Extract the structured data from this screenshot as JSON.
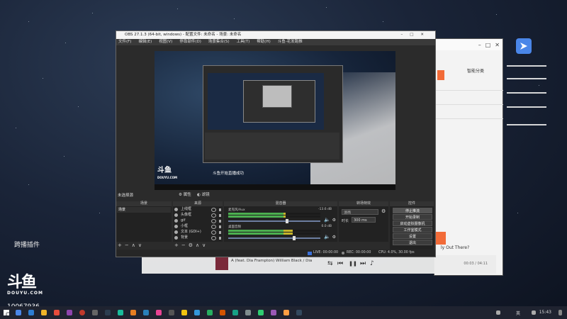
{
  "desktop": {
    "label": "跨播插件",
    "logo_text": "斗鱼",
    "logo_sub": "DOUYU.COM",
    "room_id": "10067936"
  },
  "back_window": {
    "smart_category": "智能分类",
    "question_text": "ly Out There?"
  },
  "music_player": {
    "song": "A (feat. Dia Frampton)    William Black / Dia",
    "time": "00:03 / 04:11"
  },
  "obs": {
    "title": "OBS 27.1.3 (64-bit, windows) - 配置文件: 未命名 - 场景: 未命名",
    "menu": [
      "文件(F)",
      "编辑(E)",
      "视图(V)",
      "停靠部件(D)",
      "场景集合(S)",
      "工具(T)",
      "帮助(H)",
      "斗鱼-花发跑推"
    ],
    "preview": {
      "notify": "斗鱼开始直播成功",
      "logo": "斗鱼",
      "logo_sub": "DOUYU.COM"
    },
    "toolbar": {
      "no_source": "未选择源",
      "properties": "属性",
      "filters": "滤镜"
    },
    "docks": {
      "scenes": "场景",
      "sources": "来源",
      "mixer": "混音器",
      "transitions": "转场特效",
      "controls": "控件"
    },
    "scenes": [
      "场景"
    ],
    "sources": [
      "上线框",
      "头像框",
      "gif",
      "小框",
      "文本 (GDI+)",
      "背景"
    ],
    "mixer": [
      {
        "label": "麦克风/Aux",
        "db": "-13.6 dB",
        "level": 0.62
      },
      {
        "label": "桌面音频",
        "db": "0.0 dB",
        "level": 0.7
      }
    ],
    "transitions": {
      "selected": "淡出",
      "duration_label": "时长",
      "duration_value": "300 ms"
    },
    "controls": [
      "停止推流",
      "开始录制",
      "启动虚拟摄像机",
      "工作室模式",
      "设置",
      "退出"
    ],
    "status": {
      "live": "LIVE: 00:00:00",
      "rec": "REC: 00:00:00",
      "cpu": "CPU: 4.0%, 30.00 fps"
    }
  },
  "taskbar": {
    "lang": "英",
    "time": "15:43"
  },
  "colors": {
    "accent_orange": "#f26b38",
    "meter_green": "#4caf50",
    "obs_bg": "#2b2b2b"
  }
}
